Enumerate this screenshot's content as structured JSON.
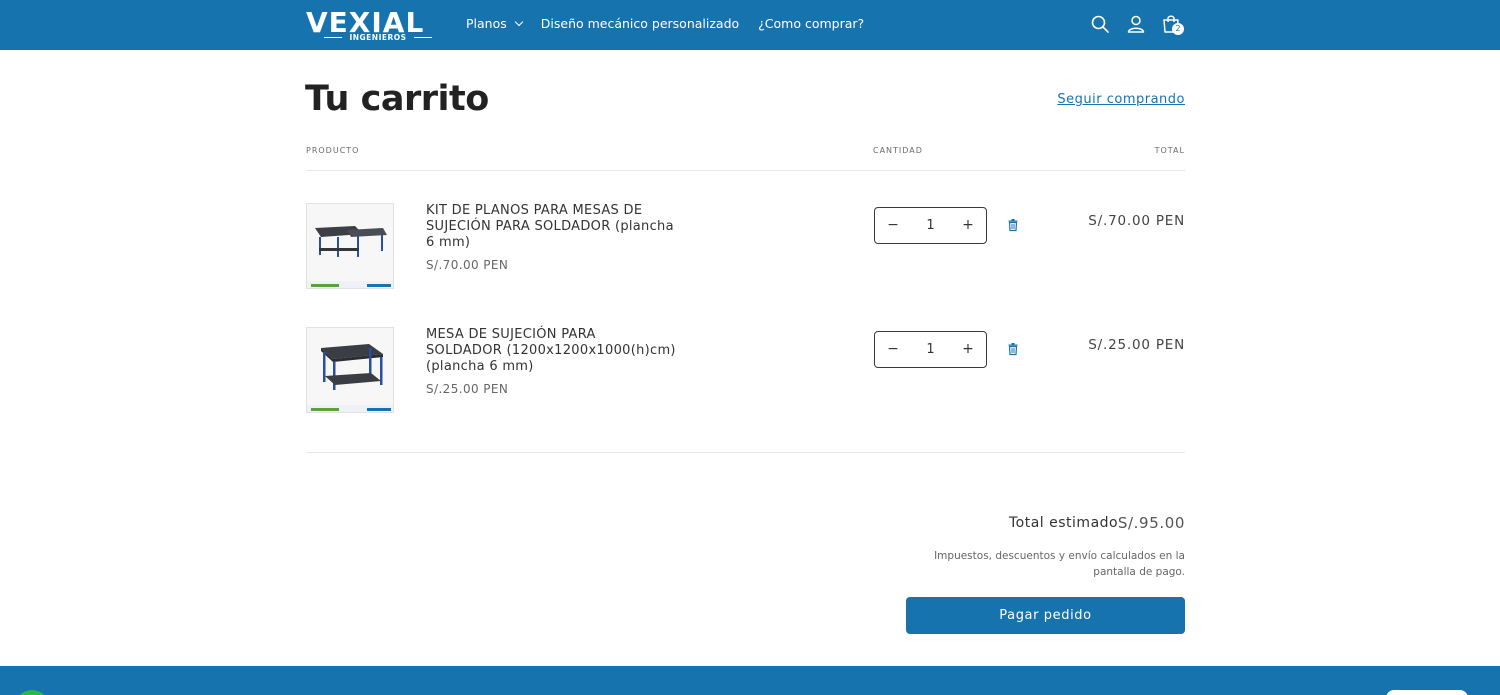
{
  "header": {
    "logo_text": "VEXIAL",
    "logo_subtext": "INGENIEROS",
    "nav": [
      {
        "label": "Planos",
        "has_dropdown": true
      },
      {
        "label": "Diseño mecánico personalizado"
      },
      {
        "label": "¿Como comprar?"
      }
    ],
    "cart_count": "2",
    "icons": [
      "search-icon",
      "account-icon",
      "cart-icon"
    ]
  },
  "cart": {
    "title": "Tu carrito",
    "continue_link": "Seguir comprando",
    "columns": {
      "product": "PRODUCTO",
      "quantity": "CANTIDAD",
      "total": "TOTAL"
    },
    "items": [
      {
        "name": "KIT DE PLANOS PARA MESAS DE SUJECIÓN PARA SOLDADOR (plancha 6 mm)",
        "price": "S/.70.00 PEN",
        "quantity": "1",
        "total": "S/.70.00 PEN"
      },
      {
        "name": "MESA DE SUJECIÓN PARA SOLDADOR (1200x1200x1000(h)cm) (plancha 6 mm)",
        "price": "S/.25.00 PEN",
        "quantity": "1",
        "total": "S/.25.00 PEN"
      }
    ],
    "qty_minus": "−",
    "qty_plus": "+"
  },
  "summary": {
    "estimated_label": "Total estimado",
    "estimated_value": "S/.95.00",
    "tax_note": "Impuestos, descuentos y envío calculados en la pantalla de pago.",
    "checkout_button": "Pagar pedido"
  },
  "colors": {
    "brand": "#1773ad",
    "background": "#ffffff",
    "text": "#2b2b2b"
  }
}
